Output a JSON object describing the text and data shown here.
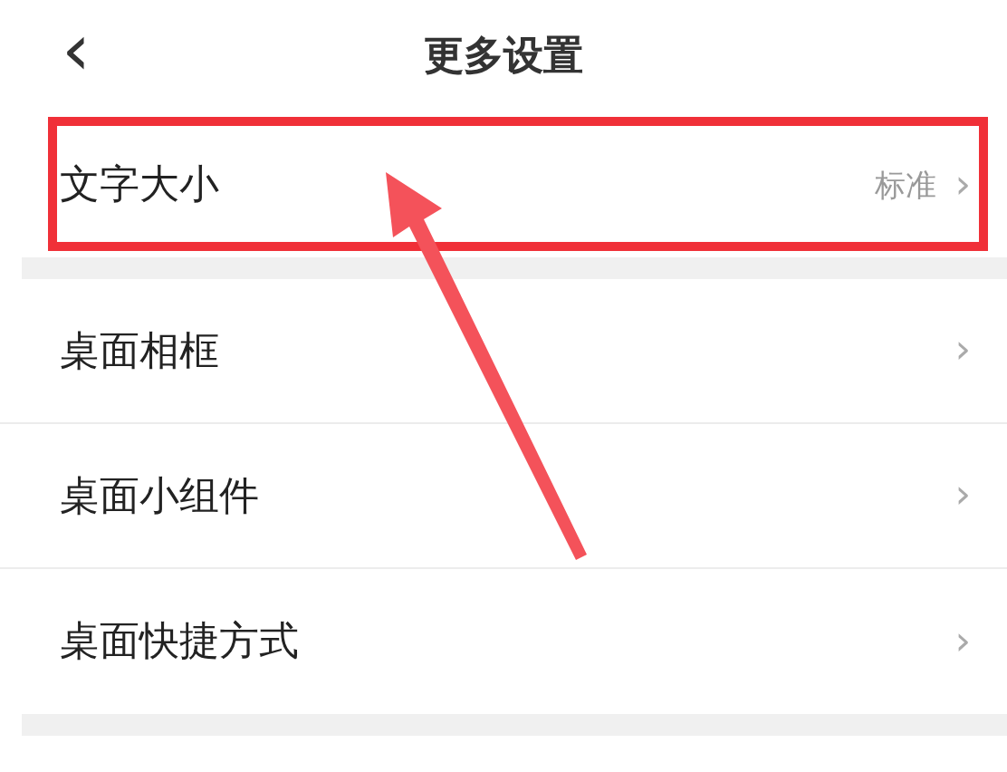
{
  "header": {
    "back": "‹",
    "title": "更多设置"
  },
  "sections": [
    {
      "rows": [
        {
          "label": "文字大小",
          "value": "标准",
          "chevron": "›"
        }
      ]
    },
    {
      "rows": [
        {
          "label": "桌面相框",
          "chevron": "›"
        },
        {
          "label": "桌面小组件",
          "chevron": "›"
        },
        {
          "label": "桌面快捷方式",
          "chevron": "›"
        }
      ]
    }
  ],
  "annotations": [
    {
      "kind": "frame"
    },
    {
      "kind": "arrow"
    }
  ]
}
